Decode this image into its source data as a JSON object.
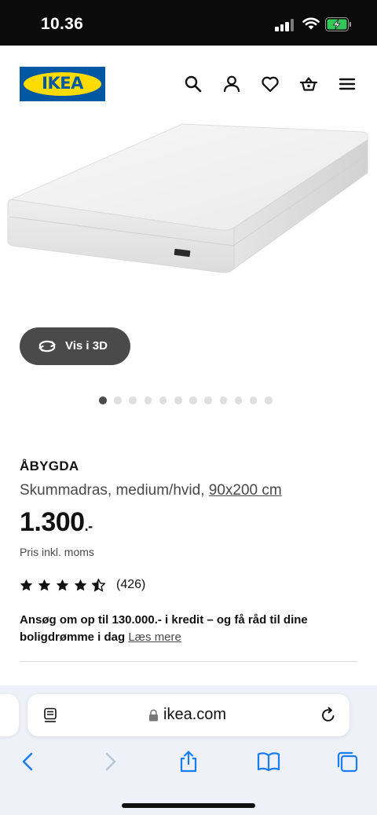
{
  "status_bar": {
    "time": "10.36",
    "battery_state": "charging"
  },
  "header": {
    "logo_text": "IKEA",
    "icons": [
      "search-icon",
      "profile-icon",
      "heart-icon",
      "basket-icon",
      "menu-icon"
    ]
  },
  "view_3d": {
    "label": "Vis i 3D"
  },
  "carousel": {
    "total": 12,
    "active_index": 0
  },
  "product": {
    "name": "ÅBYGDA",
    "description": "Skummadras, medium/hvid, ",
    "size": "90x200 cm",
    "price_main": "1.300",
    "price_decimal": ".-",
    "vat_note": "Pris inkl. moms",
    "rating": 4.5,
    "rating_max": 5,
    "review_count": "(426)"
  },
  "credit_banner": {
    "text": "Ansøg om op til 130.000.- i kredit – og få råd til dine boligdrømme i dag ",
    "link": "Læs mere"
  },
  "browser": {
    "url": "ikea.com",
    "toolbar": [
      "back-icon",
      "forward-icon",
      "share-icon",
      "bookmarks-icon",
      "tabs-icon"
    ]
  },
  "colors": {
    "ikea_blue": "#0058a3",
    "ikea_yellow": "#ffdb00",
    "button_dark": "#4a4a4a",
    "safari_blue": "#1a7cf3"
  }
}
